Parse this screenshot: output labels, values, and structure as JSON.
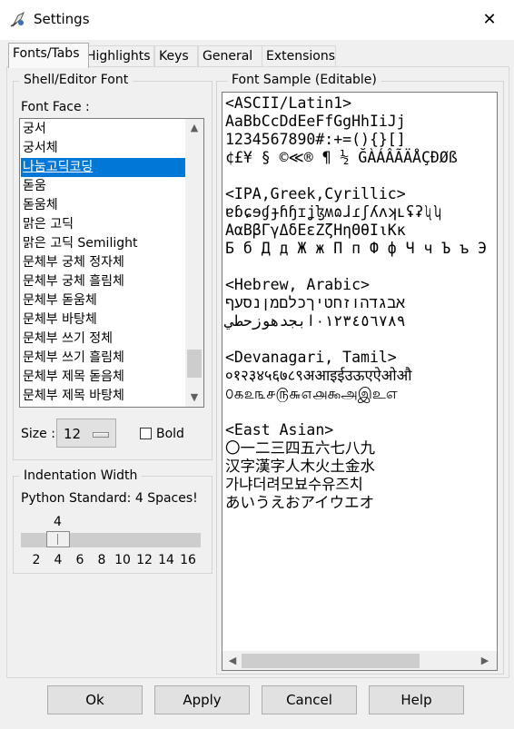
{
  "window": {
    "title": "Settings",
    "close_glyph": "✕"
  },
  "tabs": [
    {
      "label": "Fonts/Tabs"
    },
    {
      "label": "Highlights"
    },
    {
      "label": "Keys"
    },
    {
      "label": "General"
    },
    {
      "label": "Extensions"
    }
  ],
  "font_group": {
    "title": "Shell/Editor Font",
    "face_label": "Font Face :",
    "fonts": [
      "궁서",
      "궁서체",
      "나눔고딕코딩",
      "돋움",
      "돋움체",
      "맑은 고딕",
      "맑은 고딕 Semilight",
      "문체부 궁체 정자체",
      "문체부 궁체 흘림체",
      "문체부 돋움체",
      "문체부 바탕체",
      "문체부 쓰기 정체",
      "문체부 쓰기 흘림체",
      "문체부 제목 돋음체",
      "문체부 제목 바탕체"
    ],
    "selected_font": "나눔고딕코딩",
    "size_label": "Size :",
    "size_value": "12",
    "bold_label": "Bold",
    "bold_checked": false
  },
  "indent_group": {
    "title": "Indentation Width",
    "description": "Python Standard: 4 Spaces!",
    "current_value": "4",
    "ticks": [
      "2",
      "4",
      "6",
      "8",
      "10",
      "12",
      "14",
      "16"
    ]
  },
  "sample_group": {
    "title": "Font Sample (Editable)",
    "lines": [
      "<ASCII/Latin1>",
      "AaBbCcDdEeFfGgHhIiJj",
      "1234567890#:+=(){}[]",
      "¢£¥ § ©≪® ¶ ½ ĞÀÁÂÃÄÅÇÐØß",
      "",
      "<IPA,Greek,Cyrillic>",
      "ɐɓɕɘɠɟɦɧɪʝɮʍɷɺɾʃʎʌʞʟʢʡʯʮ",
      "ΑαΒβΓγΔδΕεΖζΗηΘθΙιΚκ",
      "Б б Д д Ж ж П п Ф ф Ч ч Ъ ъ Э",
      "",
      "<Hebrew, Arabic>",
      "אבגדהוזחטיךכלםמןנסעף",
      "٠١٢٣٤٥٦٧٨٩ابجدهوزحطي",
      "",
      "<Devanagari, Tamil>",
      "०१२३४५६७८९अआइईउऊएऐओऔ",
      "௦௧௨௩௪௫௬௭௮௯அஇஉஎ",
      "",
      "<East Asian>",
      "〇一二三四五六七八九",
      "汉字漢字人木火土金水",
      "가냐더려모뵤수유즈치",
      "あいうえおアイウエオ"
    ]
  },
  "buttons": {
    "ok": "Ok",
    "apply": "Apply",
    "cancel": "Cancel",
    "help": "Help"
  },
  "colors": {
    "selection": "#0078d7",
    "window_bg": "#f0f0f0"
  }
}
